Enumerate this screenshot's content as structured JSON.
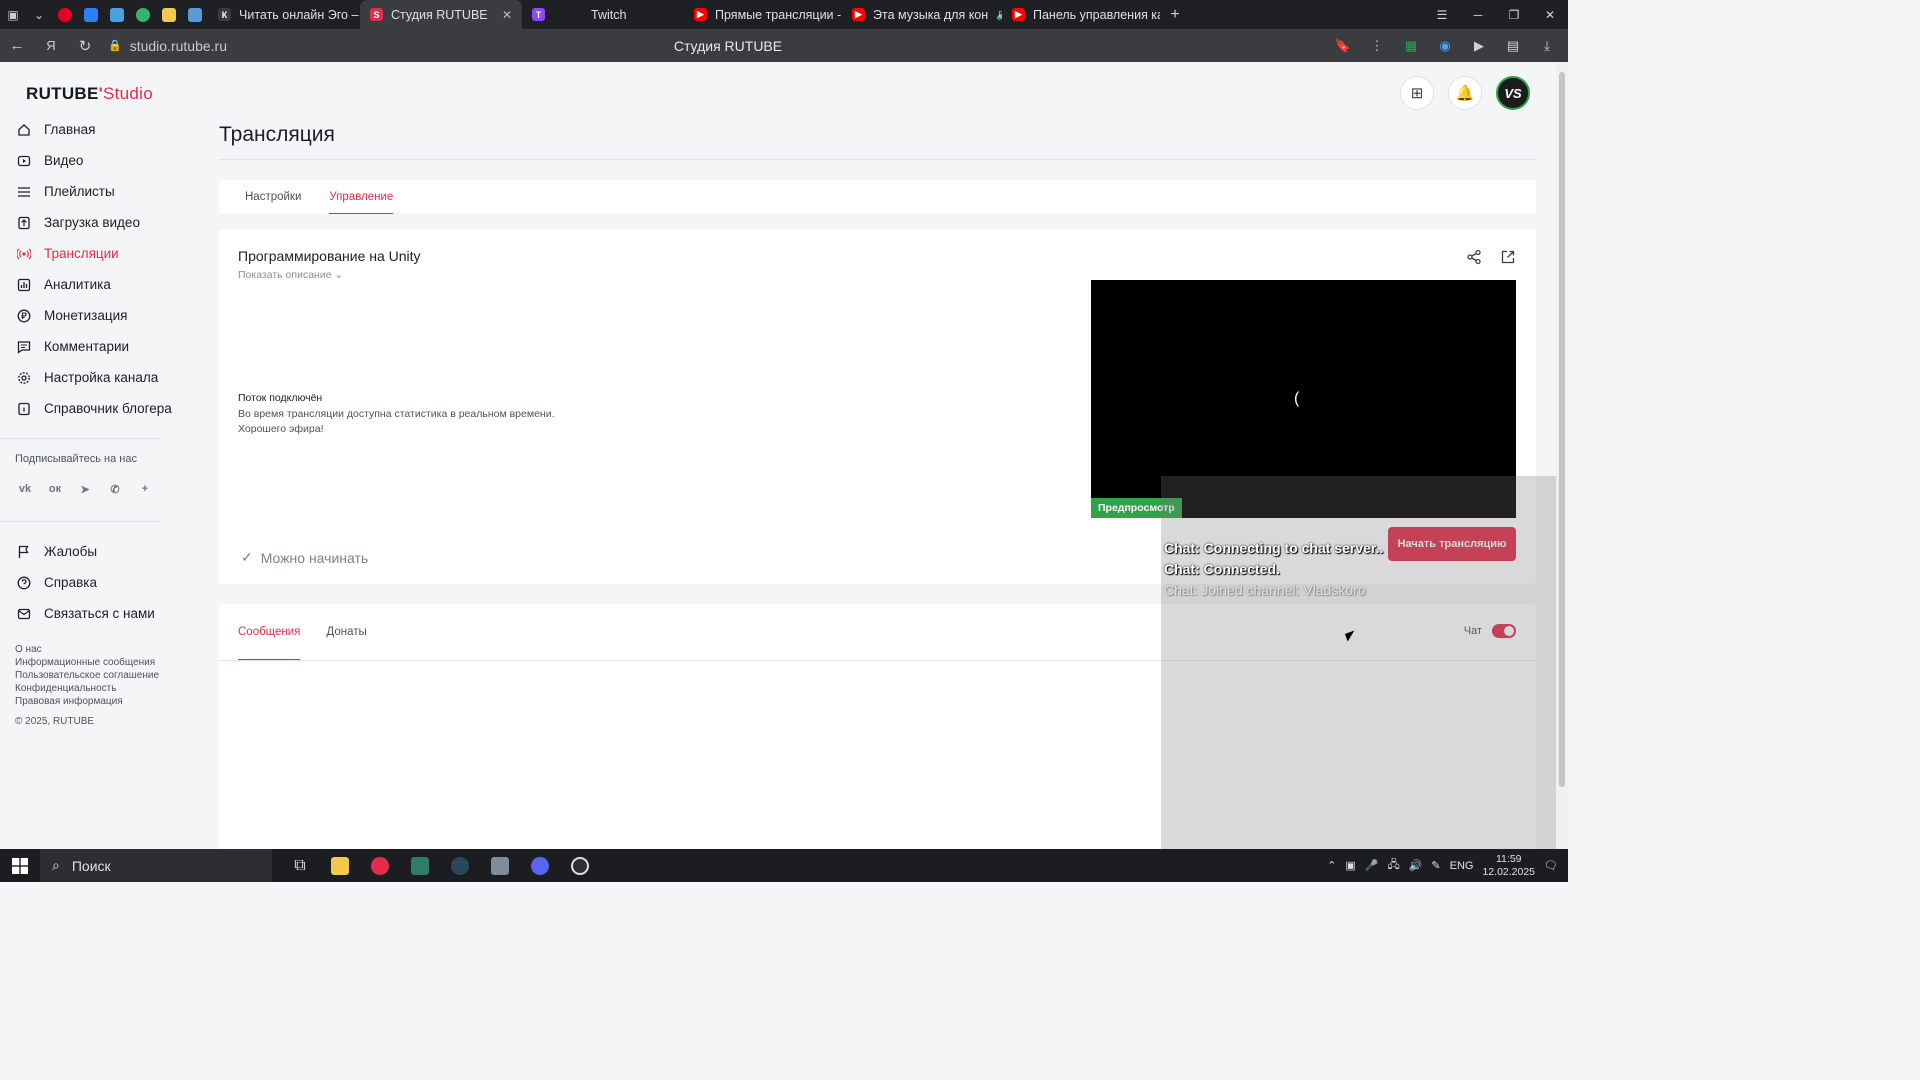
{
  "browser": {
    "tabs": [
      {
        "label": "Читать онлайн Эго – это с",
        "favicon": "К",
        "color": "#3a3a3a"
      },
      {
        "label": "Студия RUTUBE",
        "favicon": "S",
        "color": "#e42d4d",
        "active": true
      },
      {
        "label": "Twitch",
        "favicon": "T",
        "color": "#9146ff"
      },
      {
        "label": "Прямые трансляции - You",
        "favicon": "▶",
        "color": "#ff0000"
      },
      {
        "label": "Эта музыка для кон",
        "favicon": "▶",
        "color": "#ff0000"
      },
      {
        "label": "Панель управления кана",
        "favicon": "▶",
        "color": "#ff0000"
      }
    ],
    "url": "studio.rutube.ru",
    "page_title": "Студия RUTUBE"
  },
  "logo": {
    "brand": "RUTUBE",
    "suffix": "Studio"
  },
  "sidebar": {
    "items": [
      {
        "label": "Главная",
        "icon": "home-icon"
      },
      {
        "label": "Видео",
        "icon": "video-icon"
      },
      {
        "label": "Плейлисты",
        "icon": "playlist-icon"
      },
      {
        "label": "Загрузка видео",
        "icon": "upload-icon"
      },
      {
        "label": "Трансляции",
        "icon": "broadcast-icon",
        "active": true
      },
      {
        "label": "Аналитика",
        "icon": "analytics-icon"
      },
      {
        "label": "Монетизация",
        "icon": "ruble-icon"
      },
      {
        "label": "Комментарии",
        "icon": "comment-icon"
      },
      {
        "label": "Настройка канала",
        "icon": "gear-icon"
      },
      {
        "label": "Справочник блогера",
        "icon": "book-icon"
      }
    ],
    "social_title": "Подписывайтесь на нас",
    "bottom_items": [
      {
        "label": "Жалобы",
        "icon": "flag-icon"
      },
      {
        "label": "Справка",
        "icon": "help-icon"
      },
      {
        "label": "Связаться с нами",
        "icon": "mail-icon"
      }
    ],
    "footer_links": [
      "О нас",
      "Информационные сообщения",
      "Пользовательское соглашение",
      "Конфиденциальность",
      "Правовая информация"
    ],
    "copyright": "© 2025, RUTUBE"
  },
  "header": {
    "avatar_initials": "VS"
  },
  "main": {
    "title": "Трансляция",
    "tabs": [
      {
        "label": "Настройки"
      },
      {
        "label": "Управление",
        "active": true
      }
    ],
    "stream": {
      "title": "Программирование на Unity",
      "show_description": "Показать описание",
      "status_title": "Поток подключён",
      "status_lines": [
        "Во время трансляции доступна статистика в реальном времени.",
        "Хорошего эфира!"
      ],
      "ready_text": "Можно начинать",
      "preview_badge": "Предпросмотр",
      "start_button": "Начать трансляцию"
    },
    "messages": {
      "tabs": [
        {
          "label": "Сообщения",
          "active": true
        },
        {
          "label": "Донаты"
        }
      ],
      "chat_label": "Чат",
      "chat_enabled": true
    }
  },
  "chat_overlay": {
    "lines": [
      "Chat: Connecting to chat server..",
      "Chat: Connected.",
      "Chat: Joined channel: Vladskoro"
    ]
  },
  "taskbar": {
    "search_placeholder": "Поиск",
    "language": "ENG",
    "time": "11:59",
    "date": "12.02.2025"
  },
  "colors": {
    "accent": "#e42d4d",
    "success": "#2ea34a"
  }
}
